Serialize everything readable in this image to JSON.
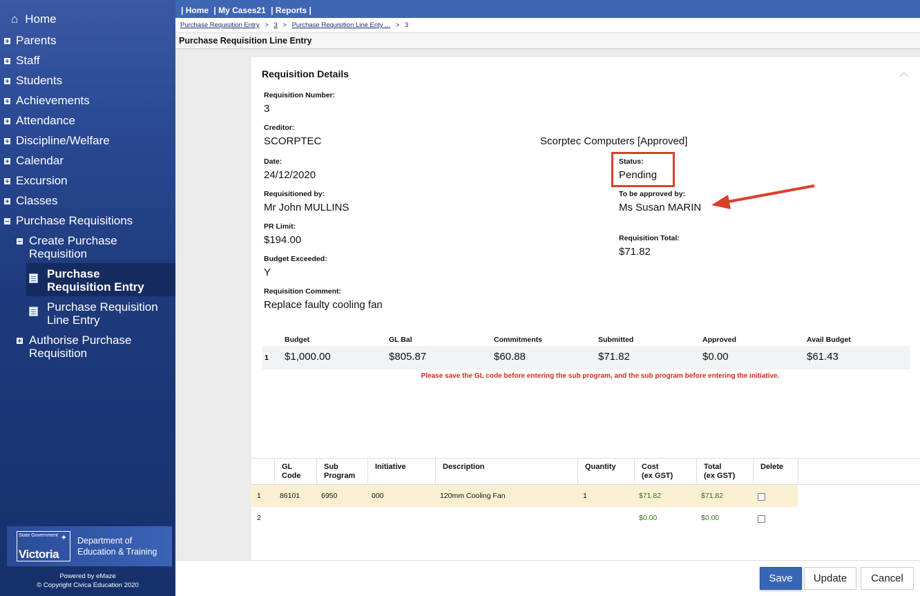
{
  "sidebar": {
    "home": "Home",
    "items": [
      "Parents",
      "Staff",
      "Students",
      "Achievements",
      "Attendance",
      "Discipline/Welfare",
      "Calendar",
      "Excursion",
      "Classes"
    ],
    "purchase_requisitions": "Purchase Requisitions",
    "create_pr_line1": "Create Purchase",
    "create_pr_line2": "Requisition",
    "pr_entry_line1": "Purchase",
    "pr_entry_line2": "Requisition Entry",
    "pr_line_entry_line1": "Purchase Requisition",
    "pr_line_entry_line2": "Line Entry",
    "authorise_line1": "Authorise Purchase",
    "authorise_line2": "Requisition",
    "logo_small": "State Government",
    "logo_big": "Victoria",
    "dept_line1": "Department of",
    "dept_line2": "Education & Training",
    "powered": "Powered by eMaze",
    "copyright": "© Copyright Civica Education 2020"
  },
  "topnav": {
    "home": "| Home",
    "mycases": "| My Cases21",
    "reports": "| Reports |"
  },
  "breadcrumb": {
    "c1": "Purchase Requisition Entry",
    "c2": "3",
    "c3": "Purchase Requisition Line Enty ...",
    "c4": "3",
    "sep": ">"
  },
  "page_title": "Purchase Requisition Line Entry",
  "details": {
    "title": "Requisition Details",
    "req_number_label": "Requisition Number:",
    "req_number": "3",
    "creditor_label": "Creditor:",
    "creditor": "SCORPTEC",
    "creditor_name": "Scorptec Computers [Approved]",
    "date_label": "Date:",
    "date": "24/12/2020",
    "status_label": "Status:",
    "status": "Pending",
    "requisitioned_label": "Requisitioned by:",
    "requisitioned": "Mr John MULLINS",
    "approver_label": "To be approved by:",
    "approver": "Ms Susan MARIN",
    "pr_limit_label": "PR Limit:",
    "pr_limit": "$194.00",
    "total_label": "Requisition Total:",
    "total": "$71.82",
    "budget_exceeded_label": "Budget Exceeded:",
    "budget_exceeded": "Y",
    "comment_label": "Requisition Comment:",
    "comment": "Replace faulty cooling fan"
  },
  "budget": {
    "headers": [
      "Budget",
      "GL Bal",
      "Commitments",
      "Submitted",
      "Approved",
      "Avail Budget"
    ],
    "row_num": "1",
    "values": [
      "$1,000.00",
      "$805.87",
      "$60.88",
      "$71.82",
      "$0.00",
      "$61.43"
    ]
  },
  "warning": "Please save the GL code before entering the sub program, and the sub program before entering the initiative.",
  "lines": {
    "headers": {
      "gl1": "GL",
      "gl2": "Code",
      "sub1": "Sub",
      "sub2": "Program",
      "initiative": "Initiative",
      "description": "Description",
      "quantity": "Quantity",
      "cost1": "Cost",
      "cost2": "(ex GST)",
      "total1": "Total",
      "total2": "(ex GST)",
      "delete": "Delete"
    },
    "rows": [
      {
        "num": "1",
        "gl": "86101",
        "sub": "6950",
        "initiative": "000",
        "description": "120mm Cooling Fan",
        "quantity": "1",
        "cost": "$71.82",
        "total": "$71.82"
      },
      {
        "num": "2",
        "gl": "",
        "sub": "",
        "initiative": "",
        "description": "",
        "quantity": "",
        "cost": "$0.00",
        "total": "$0.00"
      }
    ]
  },
  "buttons": {
    "save": "Save",
    "update": "Update",
    "cancel": "Cancel"
  },
  "colors": {
    "accent": "#3e66b4",
    "highlight_row": "#faf0d1",
    "status_box": "#d9412a",
    "warning": "#d42a1c"
  }
}
